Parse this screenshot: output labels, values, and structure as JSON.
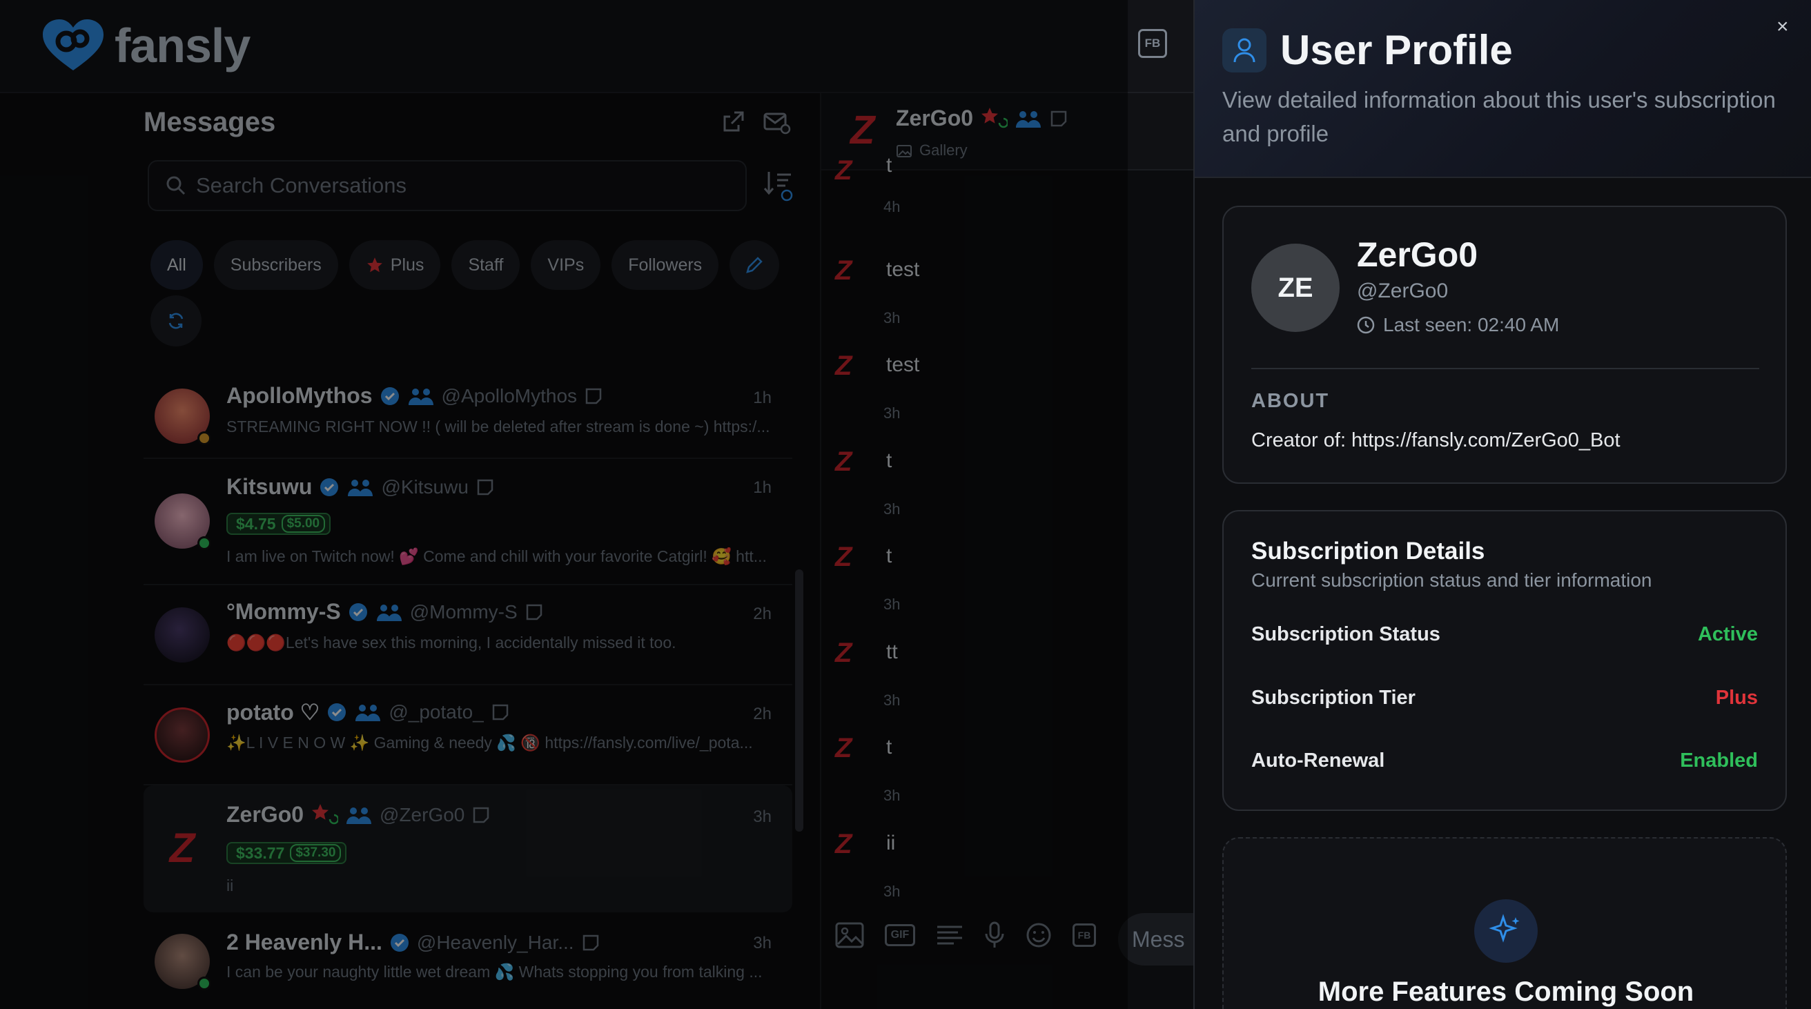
{
  "brand": {
    "name": "fansly",
    "fb_label": "FB"
  },
  "messages": {
    "title": "Messages",
    "search_placeholder": "Search Conversations",
    "filters": [
      "All",
      "Subscribers",
      "Plus",
      "Staff",
      "VIPs",
      "Followers"
    ],
    "conversations": [
      {
        "name": "ApolloMythos",
        "handle": "@ApolloMythos",
        "time": "1h",
        "preview": "STREAMING RIGHT NOW !! ( will be deleted after stream is done ~) https:/..."
      },
      {
        "name": "Kitsuwu",
        "handle": "@Kitsuwu",
        "time": "1h",
        "price": "$4.75",
        "price_orig": "$5.00",
        "preview": "I am live on Twitch now! 💕 Come and chill with your favorite Catgirl! 🥰 htt..."
      },
      {
        "name": "°Mommy-S",
        "handle": "@Mommy-S",
        "time": "2h",
        "preview": "🔴🔴🔴Let's have sex this morning, I accidentally missed it too."
      },
      {
        "name": "potato ♡",
        "handle": "@_potato_",
        "time": "2h",
        "preview": "✨L I V E N O W ✨ Gaming & needy 💦 🔞 https://fansly.com/live/_pota..."
      },
      {
        "name": "ZerGo0",
        "handle": "@ZerGo0",
        "time": "3h",
        "price": "$33.77",
        "price_orig": "$37.30",
        "preview": "ii"
      },
      {
        "name": "2 Heavenly H...",
        "handle": "@Heavenly_Har...",
        "time": "3h",
        "preview": "I can be your naughty little wet dream 💦 Whats stopping you from talking ..."
      }
    ]
  },
  "chat": {
    "name": "ZerGo0",
    "sub": "Gallery",
    "messages": [
      {
        "text": "t",
        "time": "4h"
      },
      {
        "text": "test",
        "time": "3h"
      },
      {
        "text": "test",
        "time": "3h"
      },
      {
        "text": "t",
        "time": "3h"
      },
      {
        "text": "t",
        "time": "3h"
      },
      {
        "text": "tt",
        "time": "3h"
      },
      {
        "text": "t",
        "time": "3h"
      },
      {
        "text": "ii",
        "time": "3h"
      }
    ],
    "input_placeholder": "Mess",
    "gif_label": "GIF",
    "fb_label": "FB"
  },
  "profile": {
    "panel_title": "User Profile",
    "panel_desc": "View detailed information about this user's subscription and profile",
    "close": "×",
    "initials": "ZE",
    "name": "ZerGo0",
    "handle": "@ZerGo0",
    "last_seen": "Last seen: 02:40 AM",
    "about_label": "ABOUT",
    "about_text": "Creator of: https://fansly.com/ZerGo0_Bot",
    "subscription": {
      "title": "Subscription Details",
      "desc": "Current subscription status and tier information",
      "rows": [
        {
          "label": "Subscription Status",
          "value": "Active",
          "color": "#2fbf5b"
        },
        {
          "label": "Subscription Tier",
          "value": "Plus",
          "color": "#e0343a"
        },
        {
          "label": "Auto-Renewal",
          "value": "Enabled",
          "color": "#2fbf5b"
        }
      ]
    },
    "coming_soon": "More Features Coming Soon"
  },
  "colors": {
    "accent_blue": "#2f8ee8",
    "star_red": "#e0343a",
    "green": "#2fbf5b"
  }
}
